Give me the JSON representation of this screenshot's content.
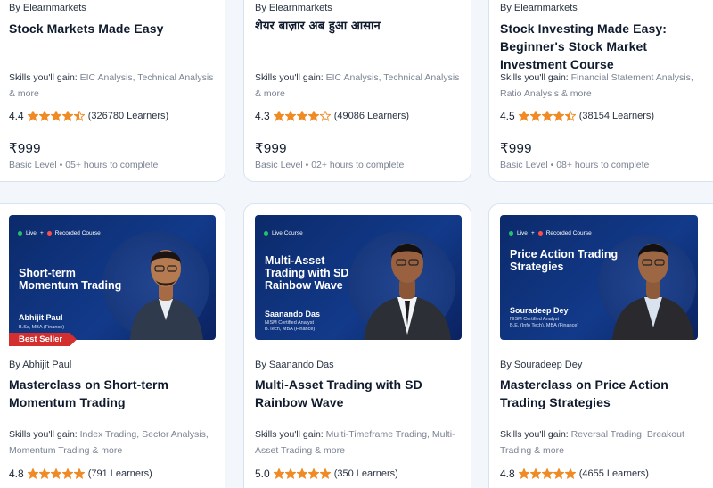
{
  "top_cards": [
    {
      "by": "By Elearnmarkets",
      "title": "Stock Markets Made Easy",
      "skills_label": "Skills you'll gain:",
      "skills": "EIC Analysis, Technical Analysis & more",
      "rating": "4.4",
      "stars": [
        1,
        1,
        1,
        1,
        0.5
      ],
      "learners": "(326780 Learners)",
      "price": "₹999",
      "level": "Basic Level • 05+ hours to complete"
    },
    {
      "by": "By Elearnmarkets",
      "title": "शेयर बाज़ार अब हुआ आसान",
      "skills_label": "Skills you'll gain:",
      "skills": "EIC Analysis, Technical Analysis & more",
      "rating": "4.3",
      "stars": [
        1,
        1,
        1,
        1,
        0
      ],
      "learners": "(49086 Learners)",
      "price": "₹999",
      "level": "Basic Level • 02+ hours to complete"
    },
    {
      "by": "By Elearnmarkets",
      "title": "Stock Investing Made Easy: Beginner's Stock Market Investment Course",
      "skills_label": "Skills you'll gain:",
      "skills": "Financial Statement Analysis, Ratio Analysis & more",
      "rating": "4.5",
      "stars": [
        1,
        1,
        1,
        1,
        0.5
      ],
      "learners": "(38154 Learners)",
      "price": "₹999",
      "level": "Basic Level • 08+ hours to complete"
    }
  ],
  "bottom_cards": [
    {
      "thumb_tags": [
        "Live",
        "+",
        "Recorded Course"
      ],
      "thumb_title": "Short-term Momentum Trading",
      "thumb_presenter": "Abhijit Paul",
      "thumb_desc": "B.Sc, MBA (Finance)",
      "badge": "Best Seller",
      "by": "By Abhijit Paul",
      "title": "Masterclass on Short-term Momentum Trading",
      "skills_label": "Skills you'll gain:",
      "skills": "Index Trading, Sector Analysis, Momentum Trading & more",
      "rating": "4.8",
      "stars": [
        1,
        1,
        1,
        1,
        1
      ],
      "learners": "(791 Learners)"
    },
    {
      "thumb_tags": [
        "Live Course"
      ],
      "thumb_title": "Multi-Asset Trading with SD Rainbow Wave",
      "thumb_presenter": "Saanando Das",
      "thumb_desc": "NISM Certified Analyst\nB.Tech, MBA (Finance)",
      "by": "By Saanando Das",
      "title": "Multi-Asset Trading with SD Rainbow Wave",
      "skills_label": "Skills you'll gain:",
      "skills": "Multi-Timeframe Trading, Multi-Asset Trading & more",
      "rating": "5.0",
      "stars": [
        1,
        1,
        1,
        1,
        1
      ],
      "learners": "(350 Learners)"
    },
    {
      "thumb_tags": [
        "Live",
        "+",
        "Recorded Course"
      ],
      "thumb_title": "Price Action Trading Strategies",
      "thumb_presenter": "Souradeep Dey",
      "thumb_desc": "NISM Certified Analyst\nB.E. (Info Tech), MBA (Finance)",
      "by": "By Souradeep Dey",
      "title": "Masterclass on Price Action Trading Strategies",
      "skills_label": "Skills you'll gain:",
      "skills": "Reversal Trading, Breakout Trading & more",
      "rating": "4.8",
      "stars": [
        1,
        1,
        1,
        1,
        1
      ],
      "learners": "(4655 Learners)"
    }
  ],
  "colors": {
    "star": "#f08a24",
    "star_empty": "#f08a24",
    "thumb_bg": "#0c2a6b",
    "badge": "#d32f2f",
    "live_dot": "#23c26b",
    "recorded_dot": "#ff4d4d"
  }
}
